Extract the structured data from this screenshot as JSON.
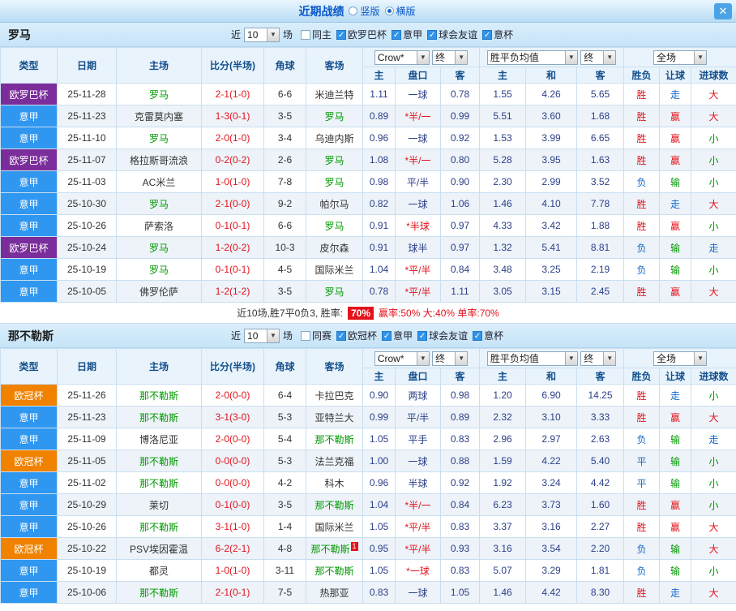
{
  "titlebar": {
    "title": "近期战绩",
    "radios": [
      {
        "label": "竖版",
        "checked": false
      },
      {
        "label": "横版",
        "checked": true
      }
    ],
    "close_label": "✕"
  },
  "filter_text": {
    "near": "近",
    "count": "10",
    "unit": "场"
  },
  "table_header": {
    "type": "类型",
    "date": "日期",
    "home": "主场",
    "score": "比分(半场)",
    "corner": "角球",
    "away": "客场",
    "odds_group": {
      "company": "Crow*",
      "final": "终",
      "home": "主",
      "handicap": "盘口",
      "away": "客"
    },
    "europe_group": {
      "avg": "胜平负均值",
      "final": "终",
      "home": "主",
      "draw": "和",
      "away": "客"
    },
    "result_group": {
      "scope": "全场",
      "result": "胜负",
      "handicap": "让球",
      "goals": "进球数"
    }
  },
  "league_colors": {
    "欧罗巴杯": "#7b2d9b",
    "意甲": "#2f97f0",
    "欧冠杯": "#f08200"
  },
  "value_colors": {
    "胜": "#e3131c",
    "负": "#1569c9",
    "平": "#1569c9",
    "赢": "#e3131c",
    "输": "#009900",
    "走": "#1569c9",
    "大": "#e3131c",
    "小": "#009900"
  },
  "focal_color": "#009900",
  "sections": [
    {
      "team": "罗马",
      "filters": [
        {
          "label": "同主",
          "checked": false
        },
        {
          "label": "欧罗巴杯",
          "checked": true
        },
        {
          "label": "意甲",
          "checked": true
        },
        {
          "label": "球会友谊",
          "checked": true
        },
        {
          "label": "意杯",
          "checked": true
        }
      ],
      "rows": [
        {
          "league": "欧罗巴杯",
          "date": "25-11-28",
          "home": "罗马",
          "score": "2-1(1-0)",
          "corner": "6-6",
          "away": "米迪兰特",
          "o_home": "1.11",
          "o_pk": "一球",
          "o_away": "0.78",
          "e_home": "1.55",
          "e_draw": "4.26",
          "e_away": "5.65",
          "result": "胜",
          "rang": "走",
          "goal": "大"
        },
        {
          "league": "意甲",
          "date": "25-11-23",
          "home": "克雷莫内塞",
          "score": "1-3(0-1)",
          "corner": "3-5",
          "away": "罗马",
          "o_home": "0.89",
          "o_pk": "*半/一",
          "o_away": "0.99",
          "e_home": "5.51",
          "e_draw": "3.60",
          "e_away": "1.68",
          "result": "胜",
          "rang": "赢",
          "goal": "大"
        },
        {
          "league": "意甲",
          "date": "25-11-10",
          "home": "罗马",
          "score": "2-0(1-0)",
          "corner": "3-4",
          "away": "乌迪内斯",
          "o_home": "0.96",
          "o_pk": "一球",
          "o_away": "0.92",
          "e_home": "1.53",
          "e_draw": "3.99",
          "e_away": "6.65",
          "result": "胜",
          "rang": "赢",
          "goal": "小"
        },
        {
          "league": "欧罗巴杯",
          "date": "25-11-07",
          "home": "格拉斯哥流浪",
          "score": "0-2(0-2)",
          "corner": "2-6",
          "away": "罗马",
          "o_home": "1.08",
          "o_pk": "*半/一",
          "o_away": "0.80",
          "e_home": "5.28",
          "e_draw": "3.95",
          "e_away": "1.63",
          "result": "胜",
          "rang": "赢",
          "goal": "小"
        },
        {
          "league": "意甲",
          "date": "25-11-03",
          "home": "AC米兰",
          "score": "1-0(1-0)",
          "corner": "7-8",
          "away": "罗马",
          "o_home": "0.98",
          "o_pk": "平/半",
          "o_away": "0.90",
          "e_home": "2.30",
          "e_draw": "2.99",
          "e_away": "3.52",
          "result": "负",
          "rang": "输",
          "goal": "小"
        },
        {
          "league": "意甲",
          "date": "25-10-30",
          "home": "罗马",
          "score": "2-1(0-0)",
          "corner": "9-2",
          "away": "帕尔马",
          "o_home": "0.82",
          "o_pk": "一球",
          "o_away": "1.06",
          "e_home": "1.46",
          "e_draw": "4.10",
          "e_away": "7.78",
          "result": "胜",
          "rang": "走",
          "goal": "大"
        },
        {
          "league": "意甲",
          "date": "25-10-26",
          "home": "萨索洛",
          "score": "0-1(0-1)",
          "corner": "6-6",
          "away": "罗马",
          "o_home": "0.91",
          "o_pk": "*半球",
          "o_away": "0.97",
          "e_home": "4.33",
          "e_draw": "3.42",
          "e_away": "1.88",
          "result": "胜",
          "rang": "赢",
          "goal": "小"
        },
        {
          "league": "欧罗巴杯",
          "date": "25-10-24",
          "home": "罗马",
          "score": "1-2(0-2)",
          "corner": "10-3",
          "away": "皮尔森",
          "o_home": "0.91",
          "o_pk": "球半",
          "o_away": "0.97",
          "e_home": "1.32",
          "e_draw": "5.41",
          "e_away": "8.81",
          "result": "负",
          "rang": "输",
          "goal": "走"
        },
        {
          "league": "意甲",
          "date": "25-10-19",
          "home": "罗马",
          "score": "0-1(0-1)",
          "corner": "4-5",
          "away": "国际米兰",
          "o_home": "1.04",
          "o_pk": "*平/半",
          "o_away": "0.84",
          "e_home": "3.48",
          "e_draw": "3.25",
          "e_away": "2.19",
          "result": "负",
          "rang": "输",
          "goal": "小"
        },
        {
          "league": "意甲",
          "date": "25-10-05",
          "home": "佛罗伦萨",
          "score": "1-2(1-2)",
          "corner": "3-5",
          "away": "罗马",
          "o_home": "0.78",
          "o_pk": "*平/半",
          "o_away": "1.11",
          "e_home": "3.05",
          "e_draw": "3.15",
          "e_away": "2.45",
          "result": "胜",
          "rang": "赢",
          "goal": "大"
        }
      ],
      "summary": {
        "text": "近10场,胜7平0负3, 胜率:",
        "rate": "70%",
        "extra": "赢率:50% 大:40% 单率:70%"
      }
    },
    {
      "team": "那不勒斯",
      "filters": [
        {
          "label": "同赛",
          "checked": false
        },
        {
          "label": "欧冠杯",
          "checked": true
        },
        {
          "label": "意甲",
          "checked": true
        },
        {
          "label": "球会友谊",
          "checked": true
        },
        {
          "label": "意杯",
          "checked": true
        }
      ],
      "rows": [
        {
          "league": "欧冠杯",
          "date": "25-11-26",
          "home": "那不勒斯",
          "score": "2-0(0-0)",
          "corner": "6-4",
          "away": "卡拉巴克",
          "o_home": "0.90",
          "o_pk": "两球",
          "o_away": "0.98",
          "e_home": "1.20",
          "e_draw": "6.90",
          "e_away": "14.25",
          "result": "胜",
          "rang": "走",
          "goal": "小"
        },
        {
          "league": "意甲",
          "date": "25-11-23",
          "home": "那不勒斯",
          "score": "3-1(3-0)",
          "corner": "5-3",
          "away": "亚特兰大",
          "o_home": "0.99",
          "o_pk": "平/半",
          "o_away": "0.89",
          "e_home": "2.32",
          "e_draw": "3.10",
          "e_away": "3.33",
          "result": "胜",
          "rang": "赢",
          "goal": "大"
        },
        {
          "league": "意甲",
          "date": "25-11-09",
          "home": "博洛尼亚",
          "score": "2-0(0-0)",
          "corner": "5-4",
          "away": "那不勒斯",
          "o_home": "1.05",
          "o_pk": "平手",
          "o_away": "0.83",
          "e_home": "2.96",
          "e_draw": "2.97",
          "e_away": "2.63",
          "result": "负",
          "rang": "输",
          "goal": "走"
        },
        {
          "league": "欧冠杯",
          "date": "25-11-05",
          "home": "那不勒斯",
          "score": "0-0(0-0)",
          "corner": "5-3",
          "away": "法兰克福",
          "o_home": "1.00",
          "o_pk": "一球",
          "o_away": "0.88",
          "e_home": "1.59",
          "e_draw": "4.22",
          "e_away": "5.40",
          "result": "平",
          "rang": "输",
          "goal": "小"
        },
        {
          "league": "意甲",
          "date": "25-11-02",
          "home": "那不勒斯",
          "score": "0-0(0-0)",
          "corner": "4-2",
          "away": "科木",
          "o_home": "0.96",
          "o_pk": "半球",
          "o_away": "0.92",
          "e_home": "1.92",
          "e_draw": "3.24",
          "e_away": "4.42",
          "result": "平",
          "rang": "输",
          "goal": "小"
        },
        {
          "league": "意甲",
          "date": "25-10-29",
          "home": "莱切",
          "score": "0-1(0-0)",
          "corner": "3-5",
          "away": "那不勒斯",
          "o_home": "1.04",
          "o_pk": "*半/一",
          "o_away": "0.84",
          "e_home": "6.23",
          "e_draw": "3.73",
          "e_away": "1.60",
          "result": "胜",
          "rang": "赢",
          "goal": "小"
        },
        {
          "league": "意甲",
          "date": "25-10-26",
          "home": "那不勒斯",
          "score": "3-1(1-0)",
          "corner": "1-4",
          "away": "国际米兰",
          "o_home": "1.05",
          "o_pk": "*平/半",
          "o_away": "0.83",
          "e_home": "3.37",
          "e_draw": "3.16",
          "e_away": "2.27",
          "result": "胜",
          "rang": "赢",
          "goal": "大"
        },
        {
          "league": "欧冠杯",
          "date": "25-10-22",
          "home": "PSV埃因霍温",
          "score": "6-2(2-1)",
          "corner": "4-8",
          "away": "那不勒斯",
          "away_badge": "1",
          "o_home": "0.95",
          "o_pk": "*平/半",
          "o_away": "0.93",
          "e_home": "3.16",
          "e_draw": "3.54",
          "e_away": "2.20",
          "result": "负",
          "rang": "输",
          "goal": "大"
        },
        {
          "league": "意甲",
          "date": "25-10-19",
          "home": "都灵",
          "score": "1-0(1-0)",
          "corner": "3-11",
          "away": "那不勒斯",
          "o_home": "1.05",
          "o_pk": "*一球",
          "o_away": "0.83",
          "e_home": "5.07",
          "e_draw": "3.29",
          "e_away": "1.81",
          "result": "负",
          "rang": "输",
          "goal": "小"
        },
        {
          "league": "意甲",
          "date": "25-10-06",
          "home": "那不勒斯",
          "score": "2-1(0-1)",
          "corner": "7-5",
          "away": "热那亚",
          "o_home": "0.83",
          "o_pk": "一球",
          "o_away": "1.05",
          "e_home": "1.46",
          "e_draw": "4.42",
          "e_away": "8.30",
          "result": "胜",
          "rang": "走",
          "goal": "大"
        }
      ],
      "summary": null
    }
  ]
}
